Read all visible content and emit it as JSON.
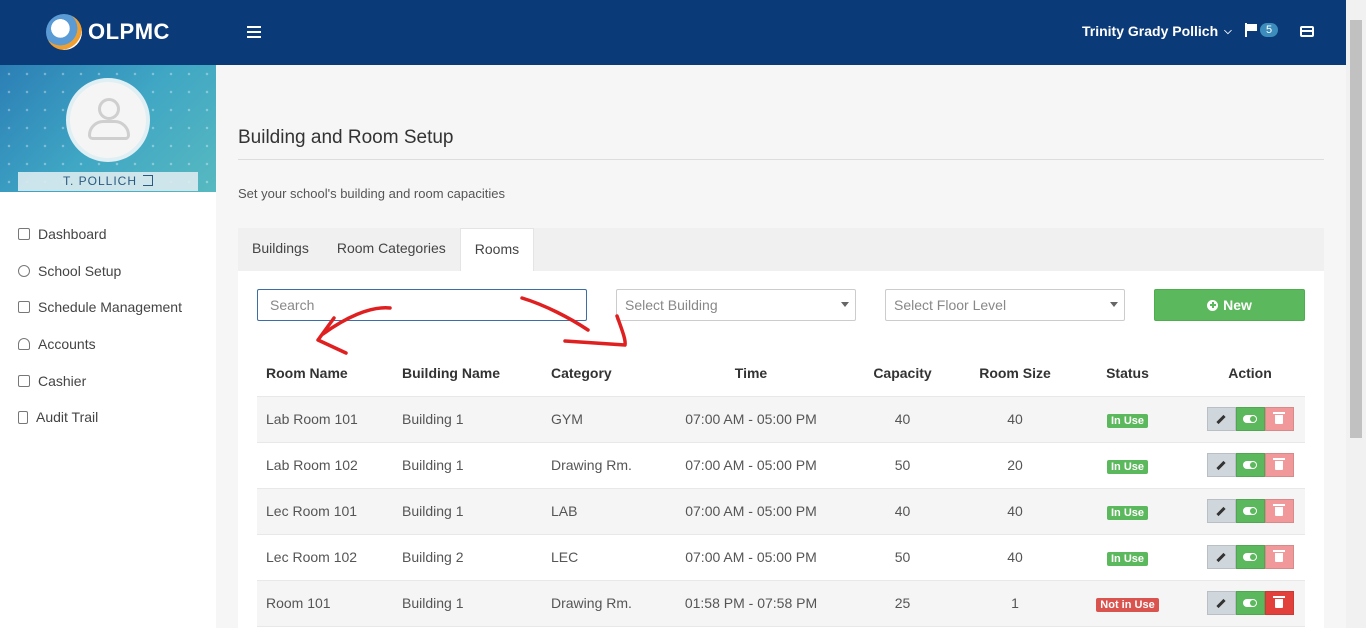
{
  "header": {
    "brand": "OLPMC",
    "user_name": "Trinity Grady Pollich",
    "notification_count": "5"
  },
  "sidebar": {
    "profile_name": "T. POLLICH",
    "items": [
      {
        "label": "Dashboard",
        "icon": "home-icon"
      },
      {
        "label": "School Setup",
        "icon": "gear-icon"
      },
      {
        "label": "Schedule Management",
        "icon": "calendar-icon"
      },
      {
        "label": "Accounts",
        "icon": "user-icon"
      },
      {
        "label": "Cashier",
        "icon": "calculator-icon"
      },
      {
        "label": "Audit Trail",
        "icon": "document-icon"
      }
    ]
  },
  "main": {
    "title": "Building and Room Setup",
    "subtitle": "Set your school's building and room capacities",
    "tabs": [
      {
        "label": "Buildings",
        "active": false
      },
      {
        "label": "Room Categories",
        "active": false
      },
      {
        "label": "Rooms",
        "active": true
      }
    ],
    "search_placeholder": "Search",
    "select_building": "Select Building",
    "select_floor": "Select Floor Level",
    "new_label": "New"
  },
  "table": {
    "columns": [
      "Room Name",
      "Building Name",
      "Category",
      "Time",
      "Capacity",
      "Room Size",
      "Status",
      "Action"
    ],
    "rows": [
      {
        "room": "Lab Room 101",
        "building": "Building 1",
        "category": "GYM",
        "time": "07:00 AM - 05:00 PM",
        "capacity": "40",
        "size": "40",
        "status": "In Use"
      },
      {
        "room": "Lab Room 102",
        "building": "Building 1",
        "category": "Drawing Rm.",
        "time": "07:00 AM - 05:00 PM",
        "capacity": "50",
        "size": "20",
        "status": "In Use"
      },
      {
        "room": "Lec Room 101",
        "building": "Building 1",
        "category": "LAB",
        "time": "07:00 AM - 05:00 PM",
        "capacity": "40",
        "size": "40",
        "status": "In Use"
      },
      {
        "room": "Lec Room 102",
        "building": "Building 2",
        "category": "LEC",
        "time": "07:00 AM - 05:00 PM",
        "capacity": "50",
        "size": "40",
        "status": "In Use"
      },
      {
        "room": "Room 101",
        "building": "Building 1",
        "category": "Drawing Rm.",
        "time": "01:58 PM - 07:58 PM",
        "capacity": "25",
        "size": "1",
        "status": "Not in Use"
      }
    ]
  },
  "colors": {
    "header_bg": "#0b3a78",
    "accent_green": "#5cb85c",
    "danger_red": "#d9534f",
    "annotation_red": "#e02020"
  }
}
